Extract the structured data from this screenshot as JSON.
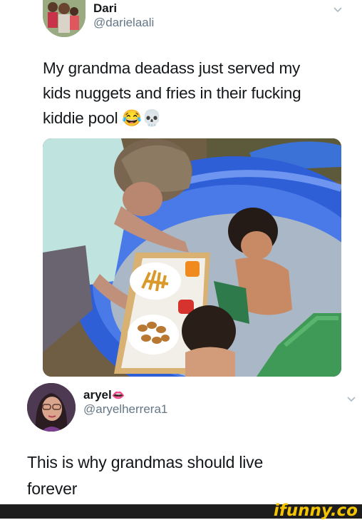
{
  "tweets": [
    {
      "author_name": "Dari",
      "author_handle": "@darielaali",
      "text_lines": [
        "My grandma deadass just served my",
        "kids nuggets and fries in their fucking",
        "kiddie pool 😂💀"
      ],
      "avatar_icon": "family-photo-avatar",
      "has_photo": true
    },
    {
      "author_name": "aryel",
      "name_emoji": "👄",
      "author_handle": "@aryelherrera1",
      "text_lines": [
        "This is why grandmas should live",
        "forever"
      ],
      "avatar_icon": "woman-selfie-avatar"
    }
  ],
  "watermark": "ifunny.co",
  "colors": {
    "pool_blue": "#2f5fd6",
    "handle_gray": "#657786",
    "brand_yellow": "#f4c400"
  }
}
